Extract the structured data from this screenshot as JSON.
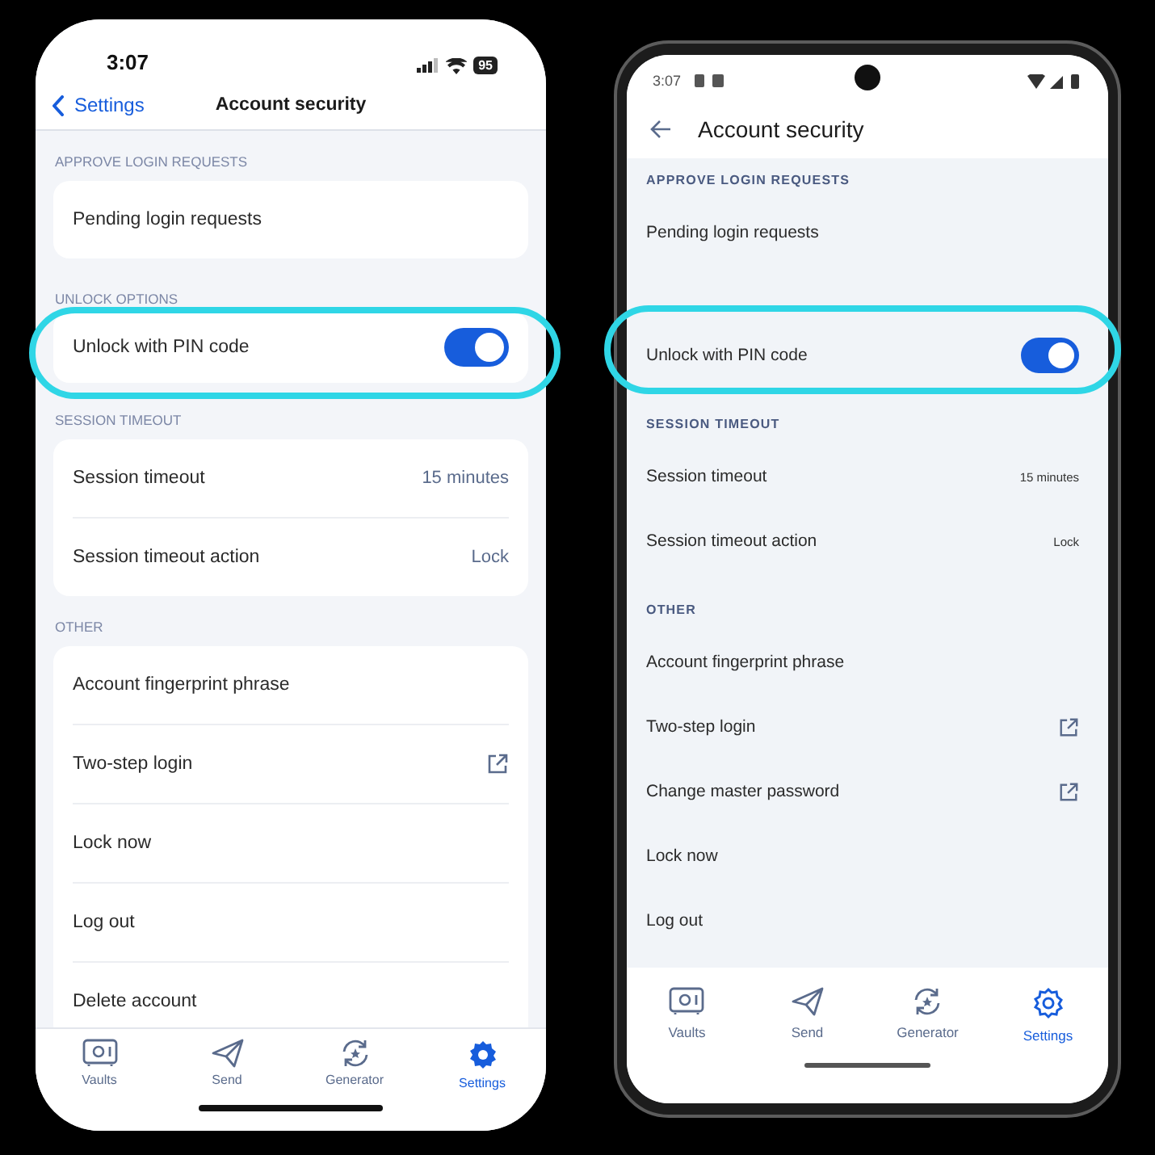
{
  "ios_phone": {
    "status_bar": {
      "time": "3:07",
      "battery": "95"
    },
    "nav_bar": {
      "back_label": "Settings",
      "title": "Account security"
    },
    "sections": [
      {
        "header": "APPROVE LOGIN REQUESTS",
        "rows": [
          {
            "kind": "nav",
            "label": "Pending login requests"
          }
        ]
      },
      {
        "header": "UNLOCK OPTIONS",
        "rows": [
          {
            "kind": "toggle",
            "label": "Unlock with PIN code",
            "on": true
          }
        ]
      },
      {
        "header": "SESSION TIMEOUT",
        "rows": [
          {
            "kind": "value",
            "label": "Session timeout",
            "value": "15 minutes"
          },
          {
            "kind": "value",
            "label": "Session timeout action",
            "value": "Lock"
          }
        ]
      },
      {
        "header": "OTHER",
        "rows": [
          {
            "kind": "nav",
            "label": "Account fingerprint phrase"
          },
          {
            "kind": "external",
            "label": "Two-step login"
          },
          {
            "kind": "nav",
            "label": "Lock now"
          },
          {
            "kind": "nav",
            "label": "Log out"
          },
          {
            "kind": "nav",
            "label": "Delete account"
          }
        ]
      }
    ],
    "tab_bar": [
      {
        "label": "Vaults",
        "selected": false
      },
      {
        "label": "Send",
        "selected": false
      },
      {
        "label": "Generator",
        "selected": false
      },
      {
        "label": "Settings",
        "selected": true
      }
    ]
  },
  "android_phone": {
    "status_bar": {
      "time": "3:07"
    },
    "top_bar": {
      "title": "Account security"
    },
    "sections": [
      {
        "header": "APPROVE LOGIN REQUESTS",
        "rows": [
          {
            "kind": "nav",
            "label": "Pending login requests"
          }
        ]
      },
      {
        "rows": [
          {
            "kind": "toggle",
            "label": "Unlock with PIN code",
            "on": true
          }
        ]
      },
      {
        "header": "SESSION TIMEOUT",
        "rows": [
          {
            "kind": "value",
            "label": "Session timeout",
            "value": "15 minutes"
          },
          {
            "kind": "value",
            "label": "Session timeout action",
            "value": "Lock"
          }
        ]
      },
      {
        "header": "OTHER",
        "rows": [
          {
            "kind": "nav",
            "label": "Account fingerprint phrase"
          },
          {
            "kind": "external",
            "label": "Two-step login"
          },
          {
            "kind": "external",
            "label": "Change master password"
          },
          {
            "kind": "nav",
            "label": "Lock now"
          },
          {
            "kind": "nav",
            "label": "Log out"
          }
        ]
      }
    ],
    "nav_bar": [
      {
        "label": "Vaults",
        "selected": false
      },
      {
        "label": "Send",
        "selected": false
      },
      {
        "label": "Generator",
        "selected": false
      },
      {
        "label": "Settings",
        "selected": true
      }
    ]
  }
}
